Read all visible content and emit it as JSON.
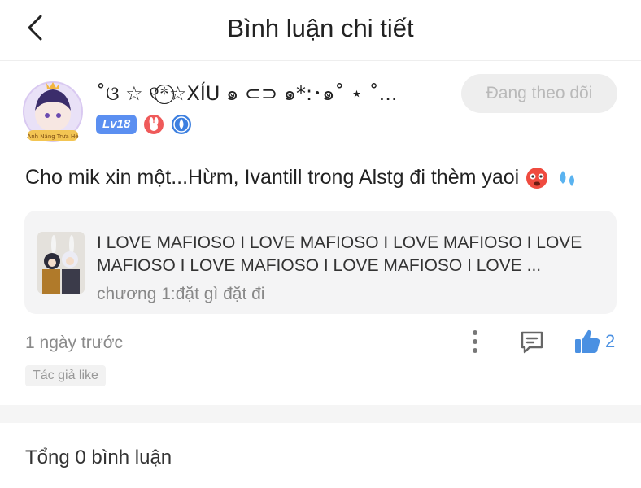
{
  "header": {
    "title": "Bình luận chi tiết",
    "back_icon": "chevron-left-icon"
  },
  "user": {
    "name": "˚ଓ ☆ ୧*⃝☆XÍU ๑ ⊂⊃ ๑*:･๑˚ ⋆ ˚...",
    "level": "Lv18",
    "avatar_caption": "Ánh Nắng Trưa Hè",
    "follow_label": "Đang theo dõi"
  },
  "comment": {
    "text": "Cho mik xin một...Hừm, Ivantill trong Alstg đi thèm yaoi"
  },
  "card": {
    "text": "I LOVE MAFIOSO I LOVE MAFIOSO I LOVE MAFIOSO I LOVE MAFIOSO I LOVE MAFIOSO I LOVE MAFIOSO I LOVE ...",
    "chapter": "chương 1:đặt gì đặt đi"
  },
  "meta": {
    "time": "1 ngày trước",
    "like_count": "2",
    "author_tag": "Tác giả like"
  },
  "footer": {
    "total": "Tổng 0 bình luận"
  },
  "colors": {
    "accent": "#4a90e2",
    "level_badge": "#5b8ff1"
  }
}
